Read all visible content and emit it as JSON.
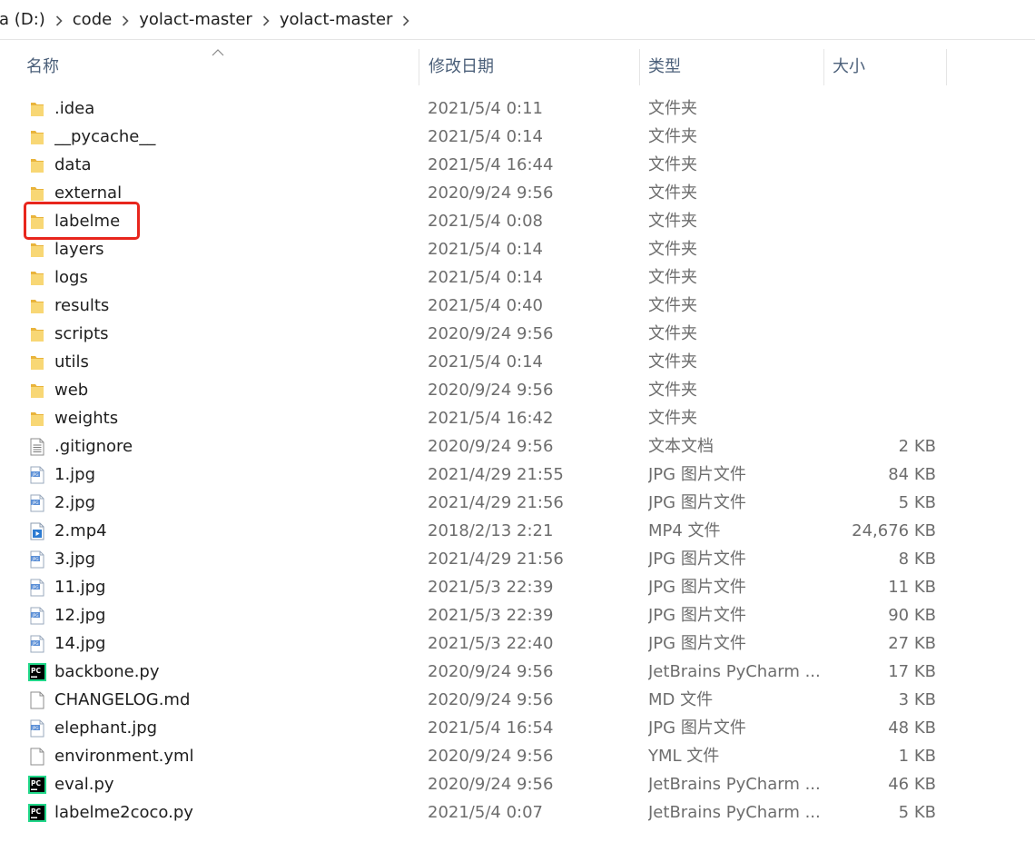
{
  "breadcrumb": {
    "items": [
      "ta (D:)",
      "code",
      "yolact-master",
      "yolact-master"
    ]
  },
  "columns": {
    "name": "名称",
    "date": "修改日期",
    "type": "类型",
    "size": "大小"
  },
  "colors": {
    "header_text": "#4c607a",
    "secondary_text": "#6d6d6d",
    "highlight_border": "#e8261d",
    "folder_yellow": "#f5c742"
  },
  "files": [
    {
      "name": ".idea",
      "date": "2021/5/4 0:11",
      "type": "文件夹",
      "size": "",
      "icon": "folder-icon"
    },
    {
      "name": "__pycache__",
      "date": "2021/5/4 0:14",
      "type": "文件夹",
      "size": "",
      "icon": "folder-icon"
    },
    {
      "name": "data",
      "date": "2021/5/4 16:44",
      "type": "文件夹",
      "size": "",
      "icon": "folder-icon"
    },
    {
      "name": "external",
      "date": "2020/9/24 9:56",
      "type": "文件夹",
      "size": "",
      "icon": "folder-icon"
    },
    {
      "name": "labelme",
      "date": "2021/5/4 0:08",
      "type": "文件夹",
      "size": "",
      "icon": "folder-icon",
      "highlighted": true
    },
    {
      "name": "layers",
      "date": "2021/5/4 0:14",
      "type": "文件夹",
      "size": "",
      "icon": "folder-icon"
    },
    {
      "name": "logs",
      "date": "2021/5/4 0:14",
      "type": "文件夹",
      "size": "",
      "icon": "folder-icon"
    },
    {
      "name": "results",
      "date": "2021/5/4 0:40",
      "type": "文件夹",
      "size": "",
      "icon": "folder-icon"
    },
    {
      "name": "scripts",
      "date": "2020/9/24 9:56",
      "type": "文件夹",
      "size": "",
      "icon": "folder-icon"
    },
    {
      "name": "utils",
      "date": "2021/5/4 0:14",
      "type": "文件夹",
      "size": "",
      "icon": "folder-icon"
    },
    {
      "name": "web",
      "date": "2020/9/24 9:56",
      "type": "文件夹",
      "size": "",
      "icon": "folder-icon"
    },
    {
      "name": "weights",
      "date": "2021/5/4 16:42",
      "type": "文件夹",
      "size": "",
      "icon": "folder-icon"
    },
    {
      "name": ".gitignore",
      "date": "2020/9/24 9:56",
      "type": "文本文档",
      "size": "2 KB",
      "icon": "text-file-icon"
    },
    {
      "name": "1.jpg",
      "date": "2021/4/29 21:55",
      "type": "JPG 图片文件",
      "size": "84 KB",
      "icon": "jpg-file-icon"
    },
    {
      "name": "2.jpg",
      "date": "2021/4/29 21:56",
      "type": "JPG 图片文件",
      "size": "5 KB",
      "icon": "jpg-file-icon"
    },
    {
      "name": "2.mp4",
      "date": "2018/2/13 2:21",
      "type": "MP4 文件",
      "size": "24,676 KB",
      "icon": "video-file-icon"
    },
    {
      "name": "3.jpg",
      "date": "2021/4/29 21:56",
      "type": "JPG 图片文件",
      "size": "8 KB",
      "icon": "jpg-file-icon"
    },
    {
      "name": "11.jpg",
      "date": "2021/5/3 22:39",
      "type": "JPG 图片文件",
      "size": "11 KB",
      "icon": "jpg-file-icon"
    },
    {
      "name": "12.jpg",
      "date": "2021/5/3 22:39",
      "type": "JPG 图片文件",
      "size": "90 KB",
      "icon": "jpg-file-icon"
    },
    {
      "name": "14.jpg",
      "date": "2021/5/3 22:40",
      "type": "JPG 图片文件",
      "size": "27 KB",
      "icon": "jpg-file-icon"
    },
    {
      "name": "backbone.py",
      "date": "2020/9/24 9:56",
      "type": "JetBrains PyCharm ...",
      "size": "17 KB",
      "icon": "pycharm-file-icon"
    },
    {
      "name": "CHANGELOG.md",
      "date": "2020/9/24 9:56",
      "type": "MD 文件",
      "size": "3 KB",
      "icon": "blank-file-icon"
    },
    {
      "name": "elephant.jpg",
      "date": "2021/5/4 16:54",
      "type": "JPG 图片文件",
      "size": "48 KB",
      "icon": "jpg-file-icon"
    },
    {
      "name": "environment.yml",
      "date": "2020/9/24 9:56",
      "type": "YML 文件",
      "size": "1 KB",
      "icon": "blank-file-icon"
    },
    {
      "name": "eval.py",
      "date": "2020/9/24 9:56",
      "type": "JetBrains PyCharm ...",
      "size": "46 KB",
      "icon": "pycharm-file-icon"
    },
    {
      "name": "labelme2coco.py",
      "date": "2021/5/4 0:07",
      "type": "JetBrains PyCharm ...",
      "size": "5 KB",
      "icon": "pycharm-file-icon"
    }
  ]
}
